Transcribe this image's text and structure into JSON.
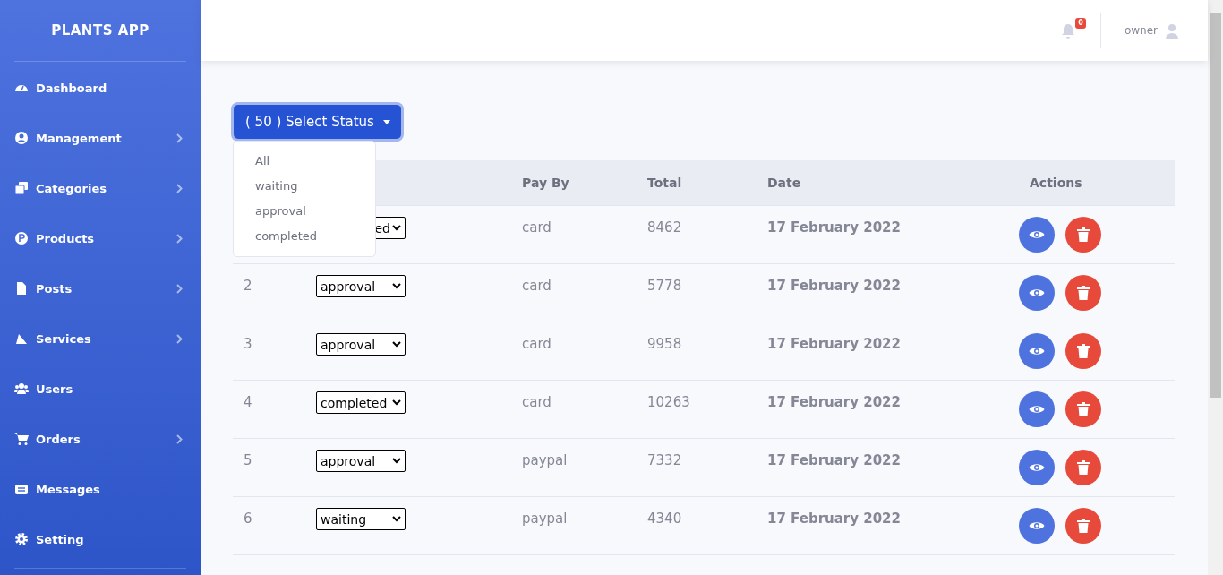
{
  "sidebar": {
    "brand": "PLANTS APP",
    "items": [
      {
        "label": "Dashboard",
        "expandable": false
      },
      {
        "label": "Management",
        "expandable": true
      },
      {
        "label": "Categories",
        "expandable": true
      },
      {
        "label": "Products",
        "expandable": true
      },
      {
        "label": "Posts",
        "expandable": true
      },
      {
        "label": "Services",
        "expandable": true
      },
      {
        "label": "Users",
        "expandable": false
      },
      {
        "label": "Orders",
        "expandable": true
      },
      {
        "label": "Messages",
        "expandable": false
      },
      {
        "label": "Setting",
        "expandable": false
      }
    ]
  },
  "topbar": {
    "notification_count": "0",
    "user": "owner"
  },
  "filter": {
    "label": "( 50 ) Select Status",
    "options": [
      "All",
      "waiting",
      "approval",
      "completed"
    ]
  },
  "table": {
    "columns": [
      "Pay By",
      "Total",
      "Date",
      "Actions"
    ],
    "rows": [
      {
        "status": "ed",
        "pay_by": "card",
        "total": "8462",
        "date": "17 February 2022"
      },
      {
        "id": "2",
        "status": "approval",
        "pay_by": "card",
        "total": "5778",
        "date": "17 February 2022"
      },
      {
        "id": "3",
        "status": "approval",
        "pay_by": "card",
        "total": "9958",
        "date": "17 February 2022"
      },
      {
        "id": "4",
        "status": "completed",
        "pay_by": "card",
        "total": "10263",
        "date": "17 February 2022"
      },
      {
        "id": "5",
        "status": "approval",
        "pay_by": "paypal",
        "total": "7332",
        "date": "17 February 2022"
      },
      {
        "id": "6",
        "status": "waiting",
        "pay_by": "paypal",
        "total": "4340",
        "date": "17 February 2022"
      }
    ]
  }
}
